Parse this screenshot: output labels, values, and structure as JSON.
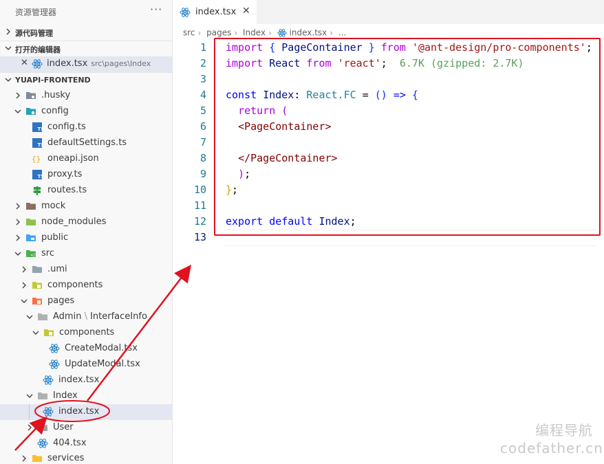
{
  "sidebar": {
    "title": "资源管理器",
    "more": "···",
    "sections": {
      "scm": "源代码管理",
      "open_editors": "打开的编辑器",
      "project": "YUAPI-FRONTEND"
    },
    "open_editor": {
      "name": "index.tsx",
      "path": "src\\pages\\Index"
    },
    "tree": [
      {
        "label": ".husky"
      },
      {
        "label": "config"
      },
      {
        "label": "config.ts"
      },
      {
        "label": "defaultSettings.ts"
      },
      {
        "label": "oneapi.json"
      },
      {
        "label": "proxy.ts"
      },
      {
        "label": "routes.ts"
      },
      {
        "label": "mock"
      },
      {
        "label": "node_modules"
      },
      {
        "label": "public"
      },
      {
        "label": "src"
      },
      {
        "label": ".umi"
      },
      {
        "label": "components"
      },
      {
        "label": "pages"
      },
      {
        "label": "Admin",
        "suffix": "InterfaceInfo"
      },
      {
        "label": "components"
      },
      {
        "label": "CreateModal.tsx"
      },
      {
        "label": "UpdateModal.tsx"
      },
      {
        "label": "index.tsx"
      },
      {
        "label": "Index"
      },
      {
        "label": "index.tsx"
      },
      {
        "label": "User"
      },
      {
        "label": "404.tsx"
      },
      {
        "label": "services"
      }
    ]
  },
  "editor": {
    "tab": {
      "label": "index.tsx",
      "close": "✕"
    },
    "breadcrumb": [
      "src",
      "pages",
      "Index",
      "index.tsx",
      "..."
    ],
    "code": {
      "line1": {
        "kw": "import",
        "b1": "{",
        "name": "PageContainer",
        "b1c": "}",
        "from": "from",
        "str": "'@ant-design/pro-components'",
        "semi": ";"
      },
      "line2": {
        "kw": "import",
        "name": "React",
        "from": "from",
        "str": "'react'",
        "semi": ";",
        "hint": "6.7K (gzipped: 2.7K)"
      },
      "line4": {
        "kw": "const",
        "name": "Index",
        "colon": ":",
        "type": "React.FC",
        "eq": "=",
        "paren": "()",
        "arrow": "=>",
        "brace": "{"
      },
      "line5": {
        "kw": "return",
        "paren": "("
      },
      "line6": {
        "tag": "<PageContainer>"
      },
      "line8": {
        "tag": "</PageContainer>"
      },
      "line9": {
        "paren": ")",
        "semi": ";"
      },
      "line10": {
        "brace": "}",
        "semi": ";"
      },
      "line12": {
        "kw1": "export",
        "kw2": "default",
        "name": "Index",
        "semi": ";"
      }
    },
    "line_numbers": [
      "1",
      "2",
      "3",
      "4",
      "5",
      "6",
      "7",
      "8",
      "9",
      "10",
      "11",
      "12",
      "13"
    ]
  },
  "watermark": {
    "cn": "编程导航",
    "en": "codefather.cn"
  },
  "colors": {
    "annotation": "#e0121f",
    "react_icon": "#1f7fc8",
    "ts_icon": "#2f74c0"
  }
}
